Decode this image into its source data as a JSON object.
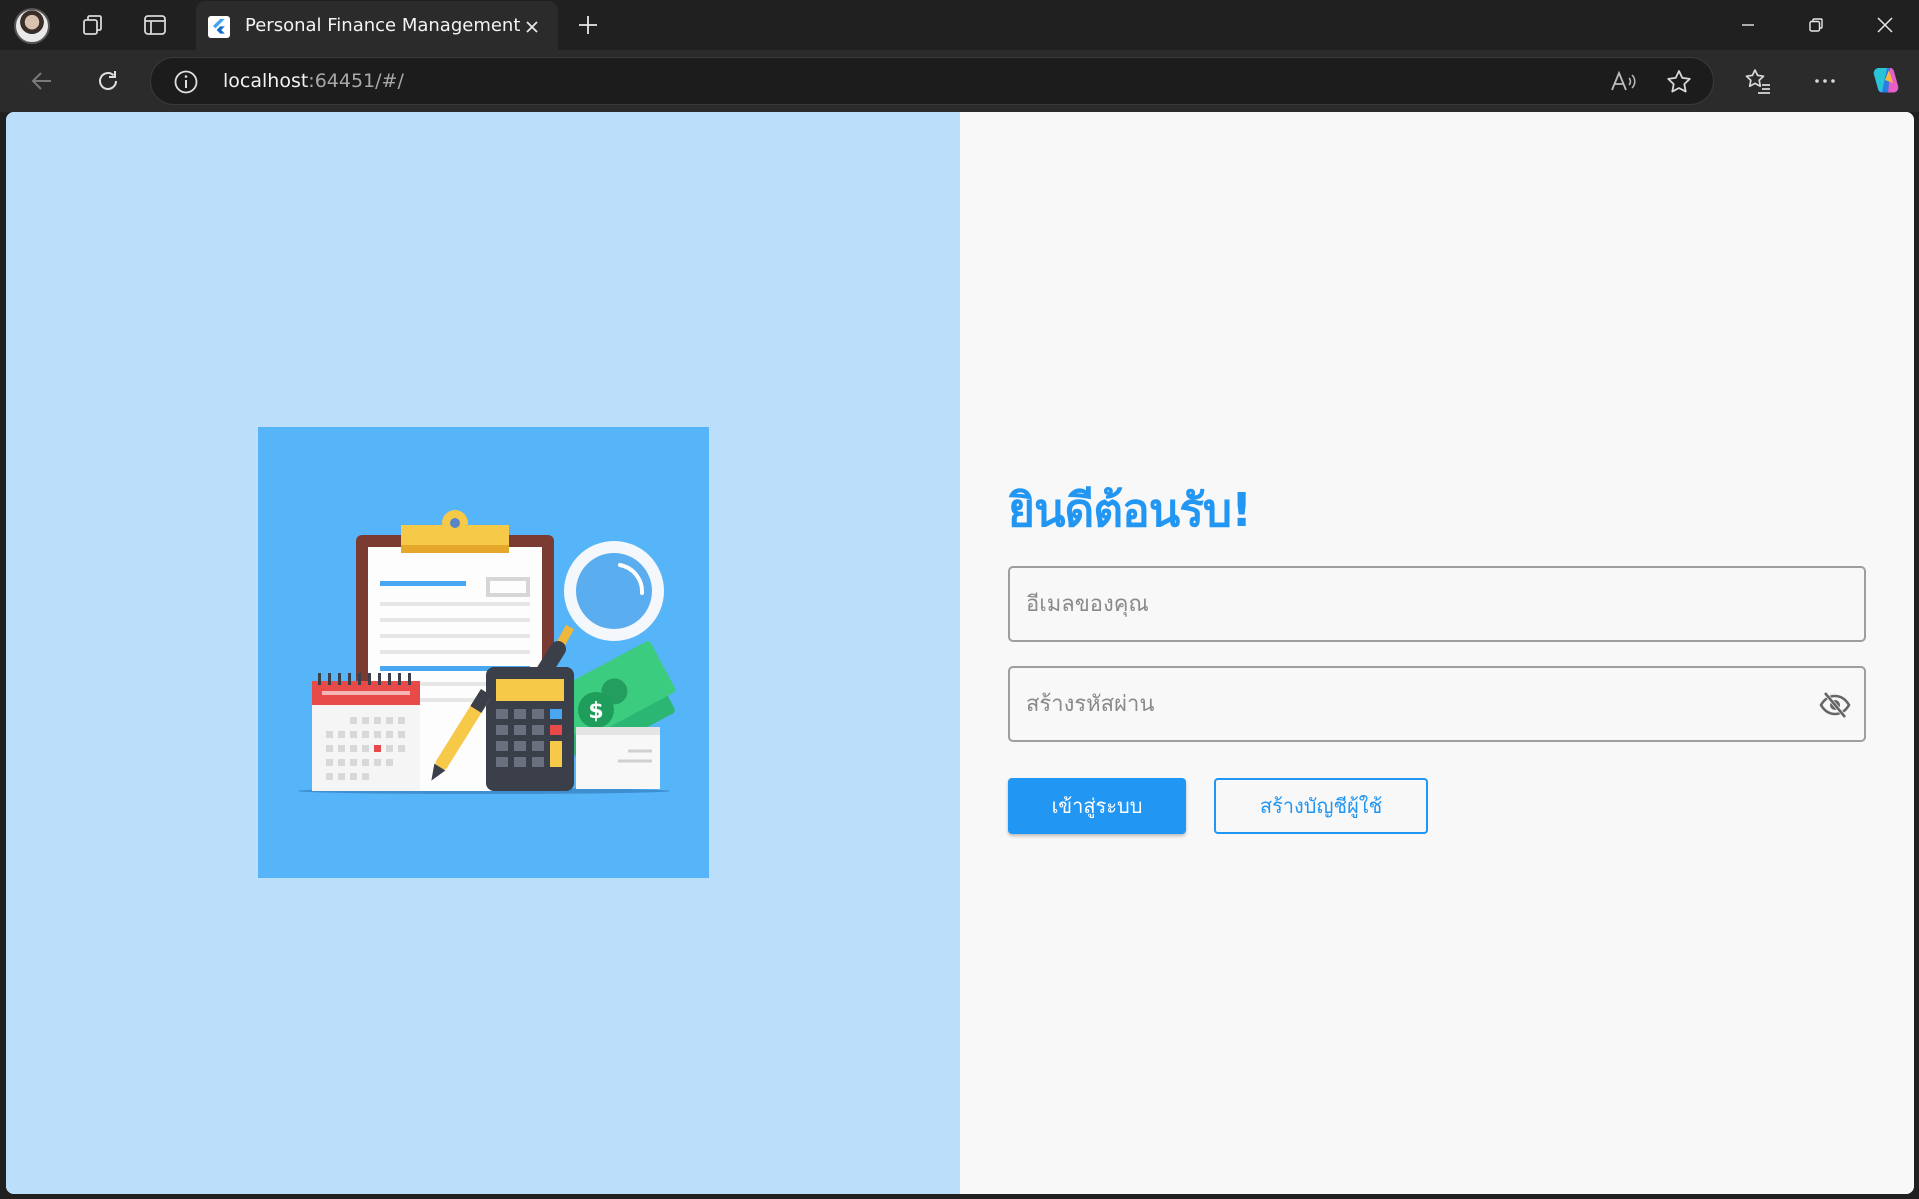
{
  "browser": {
    "tab_title": "Personal Finance Management",
    "url_host": "localhost",
    "url_rest": ":64451/#/"
  },
  "icons": {
    "profile": "avatar",
    "workspaces": "workspaces-icon",
    "tab_actions": "vertical-tabs-icon",
    "favicon": "flutter-icon",
    "close": "close-icon",
    "new_tab": "plus-icon",
    "back": "back-arrow-icon",
    "refresh": "refresh-icon",
    "site_info": "info-icon",
    "read_aloud": "read-aloud-icon",
    "favorite": "star-icon",
    "favorites": "favorites-icon",
    "more": "more-icon",
    "copilot": "copilot-icon",
    "password_visibility": "visibility-off-icon"
  },
  "login": {
    "welcome": "ยินดีต้อนรับ!",
    "email_placeholder": "อีเมลของคุณ",
    "password_placeholder": "สร้างรหัสผ่าน",
    "login_button": "เข้าสู่ระบบ",
    "register_button": "สร้างบัญชีผู้ใช้"
  },
  "colors": {
    "accent": "#2196f3",
    "left_panel": "#bbdefa",
    "illustration_bg": "#56b4f8"
  }
}
